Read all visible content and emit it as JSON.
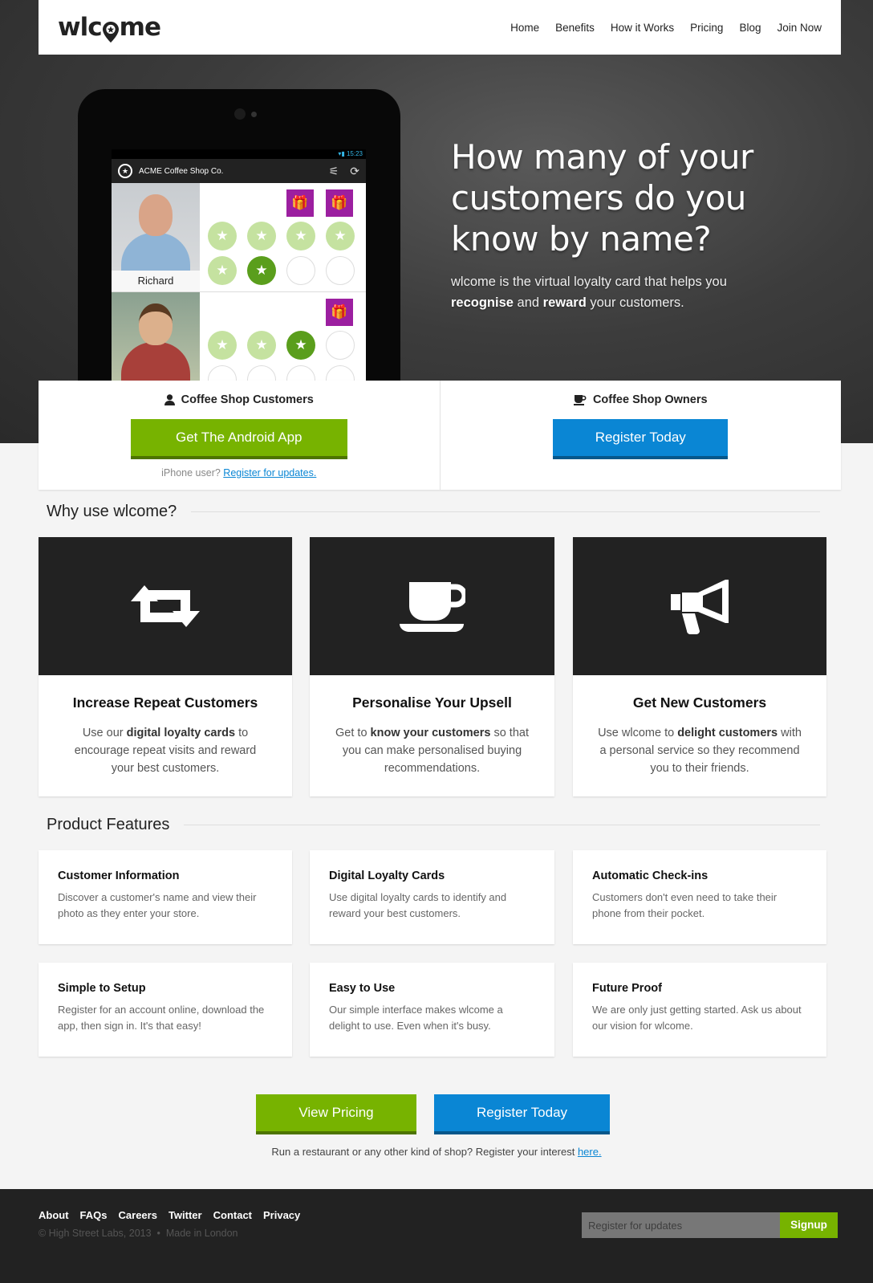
{
  "brand": {
    "logo_text_left": "wlc",
    "logo_text_right": "me"
  },
  "nav": [
    "Home",
    "Benefits",
    "How it Works",
    "Pricing",
    "Blog",
    "Join Now"
  ],
  "tablet": {
    "status_time": "15:23",
    "app_title": "ACME Coffee Shop Co.",
    "customer1_name": "Richard"
  },
  "hero": {
    "title": "How many of your customers do you know by name?",
    "sub_pre": "wlcome is the virtual loyalty card that helps you",
    "sub_b1": "recognise",
    "sub_mid": "and",
    "sub_b2": "reward",
    "sub_post": "your customers."
  },
  "cta": {
    "customers_heading": "Coffee Shop Customers",
    "android_button": "Get The Android App",
    "iphone_note": "iPhone user?",
    "iphone_link": "Register for updates.",
    "owners_heading": "Coffee Shop Owners",
    "register_button": "Register Today"
  },
  "why": {
    "title": "Why use wlcome?",
    "cards": [
      {
        "title": "Increase Repeat Customers",
        "pre": "Use our",
        "bold": "digital loyalty cards",
        "post": "to encourage repeat visits and reward your best customers.",
        "icon": "retweet-icon"
      },
      {
        "title": "Personalise Your Upsell",
        "pre": "Get to",
        "bold": "know your customers",
        "post": "so that you can make personalised buying recommendations.",
        "icon": "coffee-cup-icon"
      },
      {
        "title": "Get New Customers",
        "pre": "Use wlcome to",
        "bold": "delight customers",
        "post": "with a personal service so they recommend you to their friends.",
        "icon": "megaphone-icon"
      }
    ]
  },
  "features": {
    "title": "Product Features",
    "items": [
      {
        "title": "Customer Information",
        "text": "Discover a customer's name and view their photo as they enter your store."
      },
      {
        "title": "Digital Loyalty Cards",
        "text": "Use digital loyalty cards to identify and reward your best customers."
      },
      {
        "title": "Automatic Check-ins",
        "text": "Customers don't even need to take their phone from their pocket."
      },
      {
        "title": "Simple to Setup",
        "text": "Register for an account online, download the app, then sign in. It's that easy!"
      },
      {
        "title": "Easy to Use",
        "text": "Our simple interface makes wlcome a delight to use. Even when it's busy."
      },
      {
        "title": "Future Proof",
        "text": "We are only just getting started. Ask us about our vision for wlcome."
      }
    ]
  },
  "bottom": {
    "pricing_button": "View Pricing",
    "register_button": "Register Today",
    "note": "Run a restaurant or any other kind of shop? Register your interest",
    "note_link": "here."
  },
  "footer": {
    "links": [
      "About",
      "FAQs",
      "Careers",
      "Twitter",
      "Contact",
      "Privacy"
    ],
    "copyright": "© High Street Labs, 2013",
    "made": "Made in London",
    "signup_placeholder": "Register for updates",
    "signup_button": "Signup"
  },
  "colors": {
    "green": "#77b300",
    "blue": "#0a86d4",
    "purple": "#9c1fa0",
    "dark": "#222222"
  }
}
